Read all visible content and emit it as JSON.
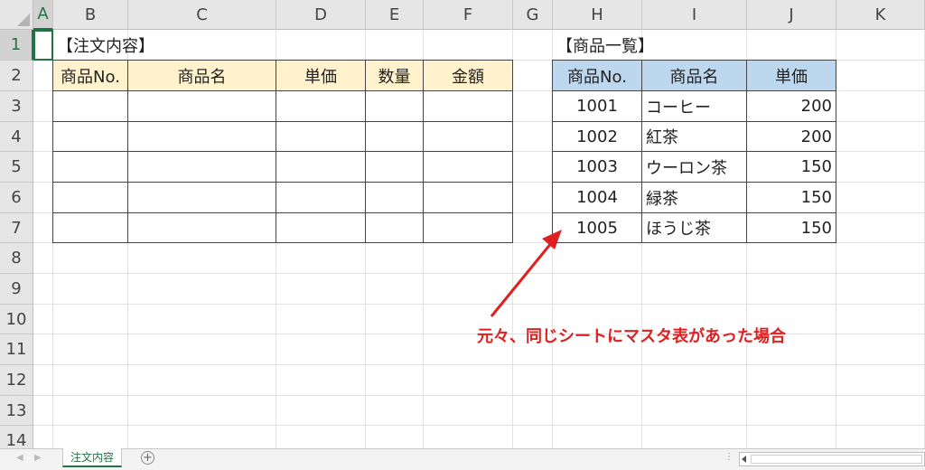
{
  "columns": [
    "A",
    "B",
    "C",
    "D",
    "E",
    "F",
    "G",
    "H",
    "I",
    "J",
    "K"
  ],
  "rows": [
    "1",
    "2",
    "3",
    "4",
    "5",
    "6",
    "7",
    "8",
    "9",
    "10",
    "11",
    "12",
    "13",
    "14"
  ],
  "selected_cell": "A1",
  "order_table": {
    "title": "【注文内容】",
    "headers": [
      "商品No.",
      "商品名",
      "単価",
      "数量",
      "金額"
    ],
    "header_fill": "#fff2cc",
    "row_count": 5
  },
  "product_table": {
    "title": "【商品一覧】",
    "headers": [
      "商品No.",
      "商品名",
      "単価"
    ],
    "header_fill": "#bdd7ee",
    "rows": [
      {
        "no": "1001",
        "name": "コーヒー",
        "price": "200"
      },
      {
        "no": "1002",
        "name": "紅茶",
        "price": "200"
      },
      {
        "no": "1003",
        "name": "ウーロン茶",
        "price": "150"
      },
      {
        "no": "1004",
        "name": "緑茶",
        "price": "150"
      },
      {
        "no": "1005",
        "name": "ほうじ茶",
        "price": "150"
      }
    ]
  },
  "annotation": {
    "text": "元々、同じシートにマスタ表があった場合",
    "color": "#e02020"
  },
  "sheet_tabs": [
    "注文内容"
  ],
  "accent_color": "#217346",
  "icons": {
    "add_sheet": "plus-circle-icon",
    "select_all": "select-all-triangle-icon",
    "scroll_left": "caret-left-icon"
  }
}
